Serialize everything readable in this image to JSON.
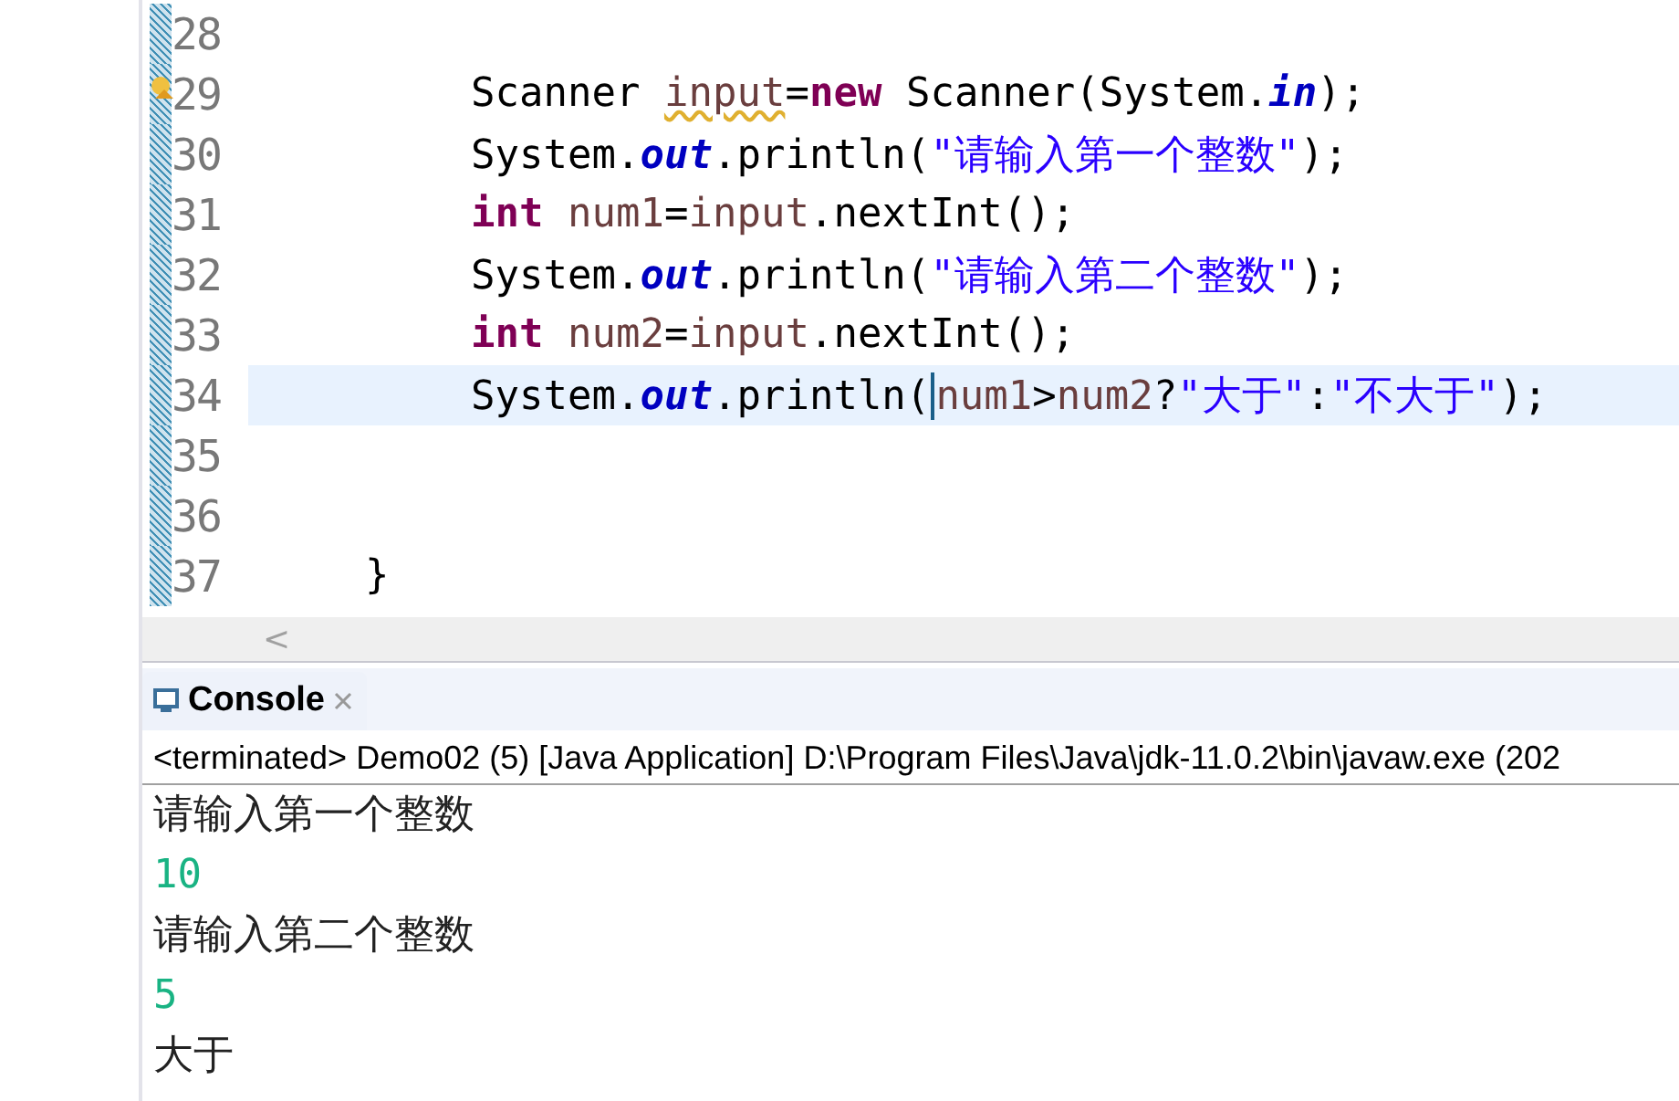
{
  "editor": {
    "lines": [
      {
        "number": "28",
        "kind": "blank",
        "current": false,
        "warning": false
      },
      {
        "number": "29",
        "kind": "statement",
        "current": false,
        "warning": true,
        "tokens": [
          {
            "text": "Scanner ",
            "kind": "plain"
          },
          {
            "text": "input",
            "kind": "flagged"
          },
          {
            "text": "=",
            "kind": "plain"
          },
          {
            "text": "new",
            "kind": "keyword"
          },
          {
            "text": " Scanner(System.",
            "kind": "plain"
          },
          {
            "text": "in",
            "kind": "field"
          },
          {
            "text": ");",
            "kind": "plain"
          }
        ]
      },
      {
        "number": "30",
        "kind": "statement",
        "current": false,
        "warning": false,
        "tokens": [
          {
            "text": "System.",
            "kind": "plain"
          },
          {
            "text": "out",
            "kind": "field"
          },
          {
            "text": ".println(",
            "kind": "plain"
          },
          {
            "text": "\"请输入第一个整数\"",
            "kind": "string"
          },
          {
            "text": ");",
            "kind": "plain"
          }
        ]
      },
      {
        "number": "31",
        "kind": "statement",
        "current": false,
        "warning": false,
        "tokens": [
          {
            "text": "int",
            "kind": "keyword"
          },
          {
            "text": " num1",
            "kind": "variable"
          },
          {
            "text": "=",
            "kind": "plain"
          },
          {
            "text": "input",
            "kind": "variable"
          },
          {
            "text": ".nextInt();",
            "kind": "plain"
          }
        ]
      },
      {
        "number": "32",
        "kind": "statement",
        "current": false,
        "warning": false,
        "tokens": [
          {
            "text": "System.",
            "kind": "plain"
          },
          {
            "text": "out",
            "kind": "field"
          },
          {
            "text": ".println(",
            "kind": "plain"
          },
          {
            "text": "\"请输入第二个整数\"",
            "kind": "string"
          },
          {
            "text": ");",
            "kind": "plain"
          }
        ]
      },
      {
        "number": "33",
        "kind": "statement",
        "current": false,
        "warning": false,
        "tokens": [
          {
            "text": "int",
            "kind": "keyword"
          },
          {
            "text": " num2",
            "kind": "variable"
          },
          {
            "text": "=",
            "kind": "plain"
          },
          {
            "text": "input",
            "kind": "variable"
          },
          {
            "text": ".nextInt();",
            "kind": "plain"
          }
        ]
      },
      {
        "number": "34",
        "kind": "statement",
        "current": true,
        "warning": false,
        "tokens": [
          {
            "text": "System.",
            "kind": "plain"
          },
          {
            "text": "out",
            "kind": "field"
          },
          {
            "text": ".println(",
            "kind": "plain"
          },
          {
            "text": "num1",
            "kind": "variable",
            "caret_before": true
          },
          {
            "text": ">",
            "kind": "plain"
          },
          {
            "text": "num2",
            "kind": "variable"
          },
          {
            "text": "?",
            "kind": "plain"
          },
          {
            "text": "\"大于\"",
            "kind": "string"
          },
          {
            "text": ":",
            "kind": "plain"
          },
          {
            "text": "\"不大于\"",
            "kind": "string"
          },
          {
            "text": ");",
            "kind": "plain"
          }
        ]
      },
      {
        "number": "35",
        "kind": "blank",
        "current": false,
        "warning": false
      },
      {
        "number": "36",
        "kind": "blank",
        "current": false,
        "warning": false
      },
      {
        "number": "37",
        "kind": "block_end",
        "current": false,
        "warning": false,
        "tokens": [
          {
            "text": "}",
            "kind": "plain"
          }
        ]
      }
    ],
    "scroll_arrow": "<"
  },
  "console": {
    "tab": {
      "label": "Console",
      "selected": true
    },
    "header": "<terminated> Demo02 (5) [Java Application] D:\\Program Files\\Java\\jdk-11.0.2\\bin\\javaw.exe (202",
    "output": [
      {
        "text": "请输入第一个整数",
        "kind": "output"
      },
      {
        "text": "10",
        "kind": "input"
      },
      {
        "text": "请输入第二个整数",
        "kind": "output"
      },
      {
        "text": "5",
        "kind": "input"
      },
      {
        "text": "大于",
        "kind": "output"
      }
    ]
  }
}
